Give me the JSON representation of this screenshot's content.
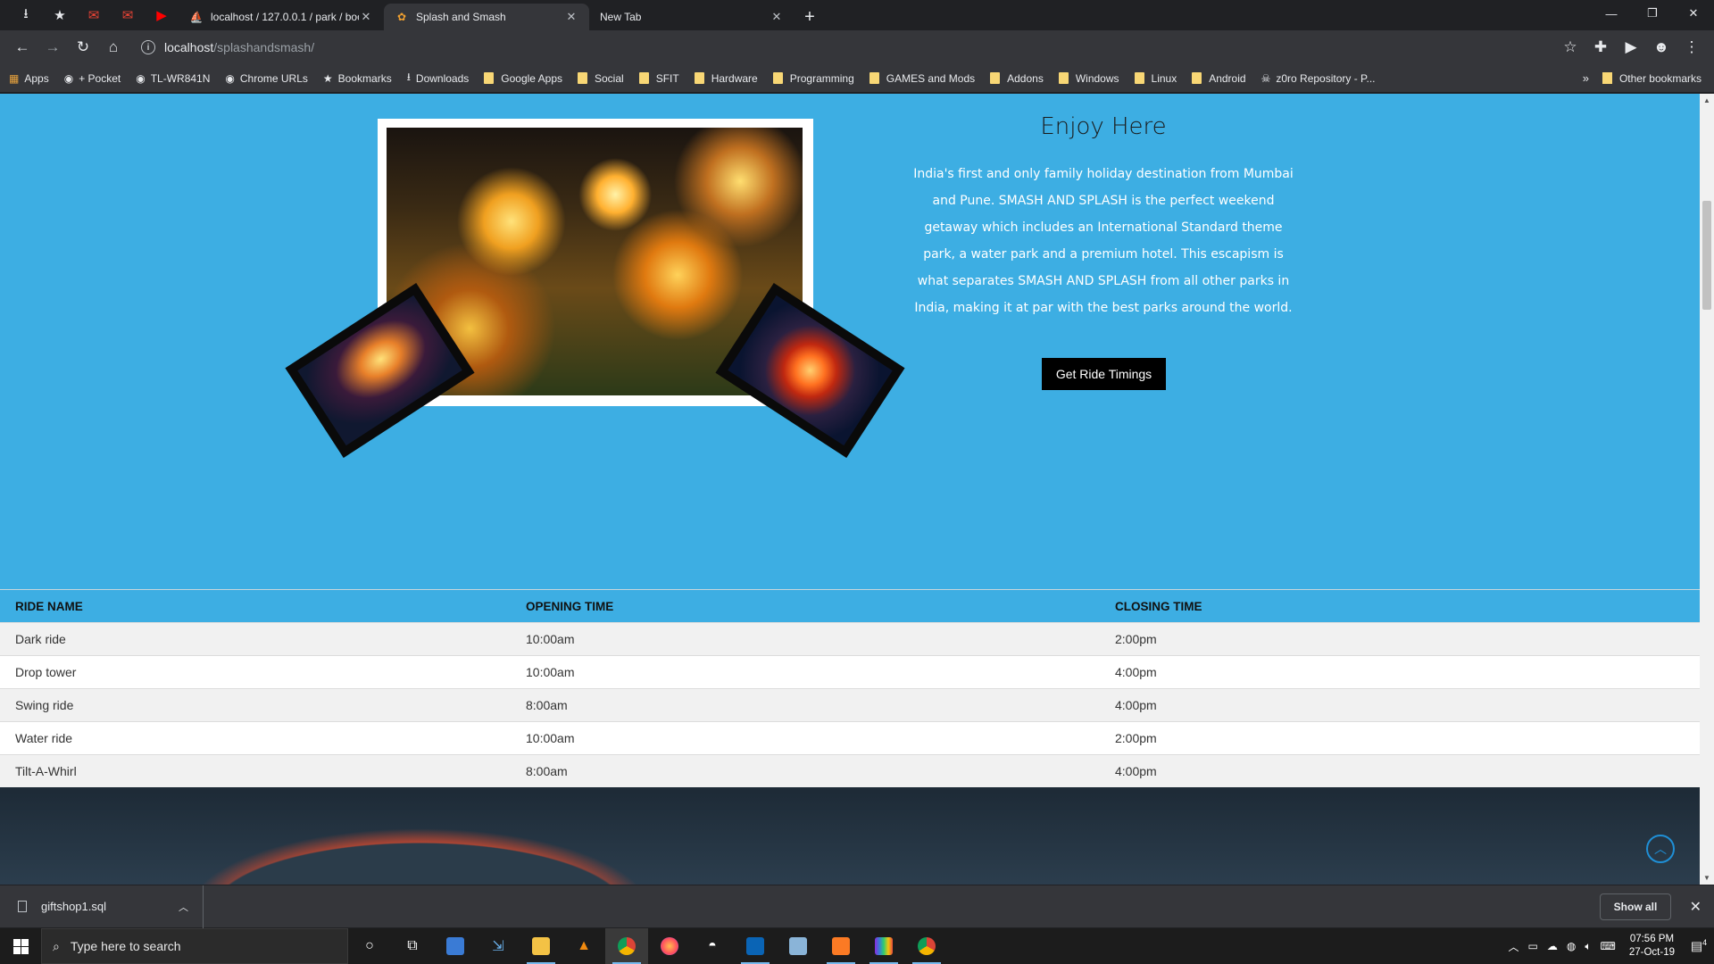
{
  "browser": {
    "tabs": [
      {
        "title": "localhost / 127.0.0.1 / park / boo",
        "active": false
      },
      {
        "title": "Splash and Smash",
        "active": true
      },
      {
        "title": "New Tab",
        "active": false
      }
    ],
    "address": {
      "host": "localhost",
      "path": "/splashandsmash/"
    },
    "bookmarks": [
      {
        "label": "Apps",
        "icon": "apps-grid-icon"
      },
      {
        "label": "+ Pocket",
        "icon": "globe-icon"
      },
      {
        "label": "TL-WR841N",
        "icon": "globe-icon"
      },
      {
        "label": "Chrome URLs",
        "icon": "globe-icon"
      },
      {
        "label": "Bookmarks",
        "icon": "star-icon"
      },
      {
        "label": "Downloads",
        "icon": "download-icon"
      },
      {
        "label": "Google Apps",
        "icon": "folder-icon"
      },
      {
        "label": "Social",
        "icon": "folder-icon"
      },
      {
        "label": "SFIT",
        "icon": "folder-icon"
      },
      {
        "label": "Hardware",
        "icon": "folder-icon"
      },
      {
        "label": "Programming",
        "icon": "folder-icon"
      },
      {
        "label": "GAMES and Mods",
        "icon": "folder-icon"
      },
      {
        "label": "Addons",
        "icon": "folder-icon"
      },
      {
        "label": "Windows",
        "icon": "folder-icon"
      },
      {
        "label": "Linux",
        "icon": "folder-icon"
      },
      {
        "label": "Android",
        "icon": "folder-icon"
      },
      {
        "label": "z0ro Repository - P...",
        "icon": "pirate-icon"
      }
    ],
    "more_bookmarks": "»",
    "other_bookmarks": "Other bookmarks"
  },
  "page": {
    "title": "Enjoy Here",
    "description": "India's first and only family holiday destination from Mumbai and Pune. SMASH AND SPLASH is the perfect weekend getaway which includes an International Standard theme park, a water park and a premium hotel. This escapism is what separates SMASH AND SPLASH from all other parks in India, making it at par with the best parks around the world.",
    "button_label": "Get Ride Timings",
    "table": {
      "headers": [
        "RIDE NAME",
        "OPENING TIME",
        "CLOSING TIME"
      ],
      "rows": [
        [
          "Dark ride",
          "10:00am",
          "2:00pm"
        ],
        [
          "Drop tower",
          "10:00am",
          "4:00pm"
        ],
        [
          "Swing ride",
          "8:00am",
          "4:00pm"
        ],
        [
          "Water ride",
          "10:00am",
          "2:00pm"
        ],
        [
          "Tilt-A-Whirl",
          "8:00am",
          "4:00pm"
        ]
      ]
    },
    "accent_color": "#3daee3"
  },
  "downloads": {
    "file": "giftshop1.sql",
    "show_all": "Show all"
  },
  "taskbar": {
    "search_placeholder": "Type here to search",
    "time": "07:56 PM",
    "date": "27-Oct-19",
    "notifications": "4"
  }
}
